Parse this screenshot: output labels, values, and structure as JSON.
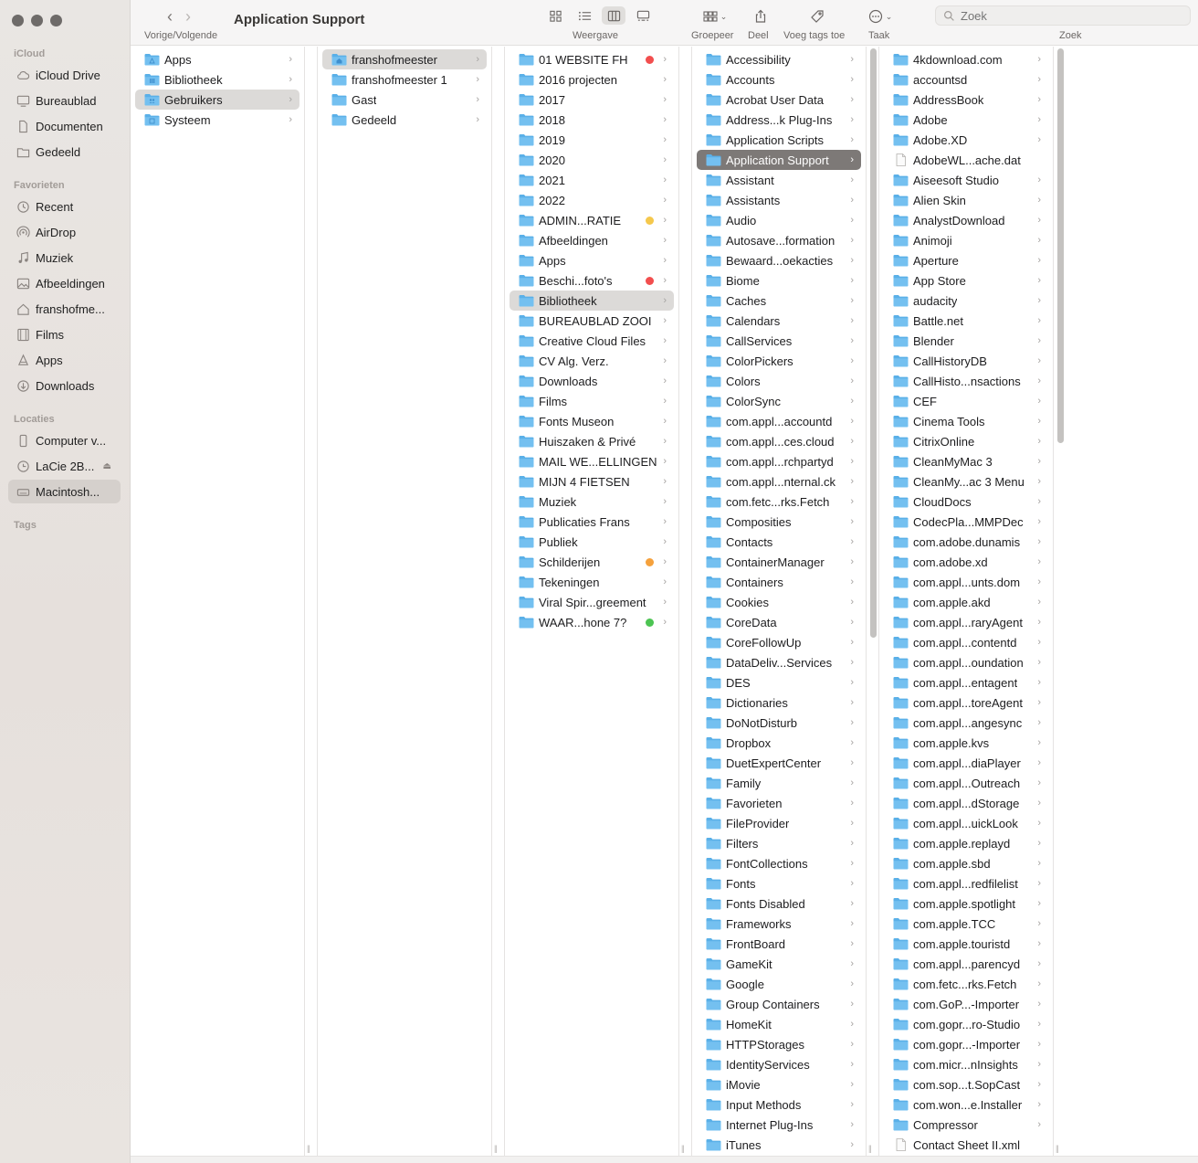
{
  "window": {
    "title": "Application Support"
  },
  "toolbar": {
    "nav_label": "Vorige/Volgende",
    "view_label": "Weergave",
    "group_label": "Groepeer",
    "share_label": "Deel",
    "tags_label": "Voeg tags toe",
    "action_label": "Taak",
    "search_label": "Zoek",
    "search_placeholder": "Zoek"
  },
  "sidebar": {
    "sections": [
      {
        "title": "iCloud",
        "items": [
          {
            "label": "iCloud Drive",
            "icon": "cloud-icon"
          },
          {
            "label": "Bureaublad",
            "icon": "desktop-icon"
          },
          {
            "label": "Documenten",
            "icon": "document-icon"
          },
          {
            "label": "Gedeeld",
            "icon": "shared-folder-icon"
          }
        ]
      },
      {
        "title": "Favorieten",
        "items": [
          {
            "label": "Recent",
            "icon": "clock-icon"
          },
          {
            "label": "AirDrop",
            "icon": "airdrop-icon"
          },
          {
            "label": "Muziek",
            "icon": "music-icon"
          },
          {
            "label": "Afbeeldingen",
            "icon": "photo-icon"
          },
          {
            "label": "franshofme...",
            "icon": "home-icon"
          },
          {
            "label": "Films",
            "icon": "film-icon"
          },
          {
            "label": "Apps",
            "icon": "apps-icon"
          },
          {
            "label": "Downloads",
            "icon": "download-icon"
          }
        ]
      },
      {
        "title": "Locaties",
        "items": [
          {
            "label": "Computer v...",
            "icon": "phone-icon"
          },
          {
            "label": "LaCie 2B...",
            "icon": "time-machine-icon",
            "eject": true
          },
          {
            "label": "Macintosh...",
            "icon": "disk-icon",
            "active": true
          }
        ]
      },
      {
        "title": "Tags",
        "items": []
      }
    ]
  },
  "columns": [
    {
      "items": [
        {
          "name": "Apps",
          "icon": "folder-apps-icon"
        },
        {
          "name": "Bibliotheek",
          "icon": "folder-library-icon"
        },
        {
          "name": "Gebruikers",
          "icon": "folder-users-icon",
          "selected": "gray"
        },
        {
          "name": "Systeem",
          "icon": "folder-system-icon"
        }
      ]
    },
    {
      "items": [
        {
          "name": "franshofmeester",
          "icon": "home-folder-icon",
          "selected": "gray"
        },
        {
          "name": "franshofmeester 1",
          "icon": "folder-icon"
        },
        {
          "name": "Gast",
          "icon": "folder-icon"
        },
        {
          "name": "Gedeeld",
          "icon": "folder-icon"
        }
      ]
    },
    {
      "items": [
        {
          "name": "01 WEBSITE FH",
          "tag": "#f24e4e"
        },
        {
          "name": "2016 projecten"
        },
        {
          "name": "2017"
        },
        {
          "name": "2018"
        },
        {
          "name": "2019"
        },
        {
          "name": "2020"
        },
        {
          "name": "2021"
        },
        {
          "name": "2022"
        },
        {
          "name": "ADMIN...RATIE",
          "tag": "#f5c84c"
        },
        {
          "name": "Afbeeldingen"
        },
        {
          "name": "Apps"
        },
        {
          "name": "Beschi...foto's",
          "tag": "#f24e4e"
        },
        {
          "name": "Bibliotheek",
          "selected": "gray"
        },
        {
          "name": "BUREAUBLAD ZOOI"
        },
        {
          "name": "Creative Cloud Files"
        },
        {
          "name": "CV Alg. Verz."
        },
        {
          "name": "Downloads"
        },
        {
          "name": "Films"
        },
        {
          "name": "Fonts Museon"
        },
        {
          "name": "Huiszaken & Privé"
        },
        {
          "name": "MAIL WE...ELLINGEN"
        },
        {
          "name": "MIJN 4 FIETSEN"
        },
        {
          "name": "Muziek"
        },
        {
          "name": "Publicaties Frans"
        },
        {
          "name": "Publiek"
        },
        {
          "name": "Schilderijen",
          "tag": "#f5a13c"
        },
        {
          "name": "Tekeningen"
        },
        {
          "name": "Viral Spir...greement"
        },
        {
          "name": "WAAR...hone 7?",
          "tag": "#4cc452"
        }
      ]
    },
    {
      "items": [
        {
          "name": "Accessibility"
        },
        {
          "name": "Accounts"
        },
        {
          "name": "Acrobat User Data"
        },
        {
          "name": "Address...k Plug-Ins"
        },
        {
          "name": "Application Scripts"
        },
        {
          "name": "Application Support",
          "selected": "dark"
        },
        {
          "name": "Assistant"
        },
        {
          "name": "Assistants"
        },
        {
          "name": "Audio"
        },
        {
          "name": "Autosave...formation"
        },
        {
          "name": "Bewaard...oekacties"
        },
        {
          "name": "Biome"
        },
        {
          "name": "Caches"
        },
        {
          "name": "Calendars"
        },
        {
          "name": "CallServices"
        },
        {
          "name": "ColorPickers"
        },
        {
          "name": "Colors"
        },
        {
          "name": "ColorSync"
        },
        {
          "name": "com.appl...accountd"
        },
        {
          "name": "com.appl...ces.cloud"
        },
        {
          "name": "com.appl...rchpartyd"
        },
        {
          "name": "com.appl...nternal.ck"
        },
        {
          "name": "com.fetc...rks.Fetch"
        },
        {
          "name": "Composities"
        },
        {
          "name": "Contacts"
        },
        {
          "name": "ContainerManager"
        },
        {
          "name": "Containers"
        },
        {
          "name": "Cookies"
        },
        {
          "name": "CoreData"
        },
        {
          "name": "CoreFollowUp"
        },
        {
          "name": "DataDeliv...Services"
        },
        {
          "name": "DES"
        },
        {
          "name": "Dictionaries"
        },
        {
          "name": "DoNotDisturb"
        },
        {
          "name": "Dropbox"
        },
        {
          "name": "DuetExpertCenter"
        },
        {
          "name": "Family"
        },
        {
          "name": "Favorieten"
        },
        {
          "name": "FileProvider"
        },
        {
          "name": "Filters"
        },
        {
          "name": "FontCollections"
        },
        {
          "name": "Fonts"
        },
        {
          "name": "Fonts Disabled"
        },
        {
          "name": "Frameworks"
        },
        {
          "name": "FrontBoard"
        },
        {
          "name": "GameKit"
        },
        {
          "name": "Google"
        },
        {
          "name": "Group Containers"
        },
        {
          "name": "HomeKit"
        },
        {
          "name": "HTTPStorages"
        },
        {
          "name": "IdentityServices"
        },
        {
          "name": "iMovie"
        },
        {
          "name": "Input Methods"
        },
        {
          "name": "Internet Plug-Ins"
        },
        {
          "name": "iTunes"
        }
      ]
    },
    {
      "items": [
        {
          "name": "4kdownload.com"
        },
        {
          "name": "accountsd"
        },
        {
          "name": "AddressBook"
        },
        {
          "name": "Adobe"
        },
        {
          "name": "Adobe.XD"
        },
        {
          "name": "AdobeWL...ache.dat",
          "file": true
        },
        {
          "name": "Aiseesoft Studio"
        },
        {
          "name": "Alien Skin"
        },
        {
          "name": "AnalystDownload"
        },
        {
          "name": "Animoji"
        },
        {
          "name": "Aperture"
        },
        {
          "name": "App Store"
        },
        {
          "name": "audacity"
        },
        {
          "name": "Battle.net"
        },
        {
          "name": "Blender"
        },
        {
          "name": "CallHistoryDB"
        },
        {
          "name": "CallHisto...nsactions"
        },
        {
          "name": "CEF"
        },
        {
          "name": "Cinema Tools"
        },
        {
          "name": "CitrixOnline"
        },
        {
          "name": "CleanMyMac 3"
        },
        {
          "name": "CleanMy...ac 3 Menu"
        },
        {
          "name": "CloudDocs"
        },
        {
          "name": "CodecPla...MMPDec"
        },
        {
          "name": "com.adobe.dunamis"
        },
        {
          "name": "com.adobe.xd"
        },
        {
          "name": "com.appl...unts.dom"
        },
        {
          "name": "com.apple.akd"
        },
        {
          "name": "com.appl...raryAgent"
        },
        {
          "name": "com.appl...contentd"
        },
        {
          "name": "com.appl...oundation"
        },
        {
          "name": "com.appl...entagent"
        },
        {
          "name": "com.appl...toreAgent"
        },
        {
          "name": "com.appl...angesync"
        },
        {
          "name": "com.apple.kvs"
        },
        {
          "name": "com.appl...diaPlayer"
        },
        {
          "name": "com.appl...Outreach"
        },
        {
          "name": "com.appl...dStorage"
        },
        {
          "name": "com.appl...uickLook"
        },
        {
          "name": "com.apple.replayd"
        },
        {
          "name": "com.apple.sbd"
        },
        {
          "name": "com.appl...redfilelist"
        },
        {
          "name": "com.apple.spotlight"
        },
        {
          "name": "com.apple.TCC"
        },
        {
          "name": "com.apple.touristd"
        },
        {
          "name": "com.appl...parencyd"
        },
        {
          "name": "com.fetc...rks.Fetch"
        },
        {
          "name": "com.GoP...-Importer"
        },
        {
          "name": "com.gopr...ro-Studio"
        },
        {
          "name": "com.gopr...-Importer"
        },
        {
          "name": "com.micr...nInsights"
        },
        {
          "name": "com.sop...t.SopCast"
        },
        {
          "name": "com.won...e.Installer"
        },
        {
          "name": "Compressor"
        },
        {
          "name": "Contact Sheet II.xml",
          "file": true
        }
      ]
    }
  ],
  "colors": {
    "folder": "#5ab0e8",
    "selection_dark": "#7d7977",
    "selection_gray": "#dcdad8"
  }
}
